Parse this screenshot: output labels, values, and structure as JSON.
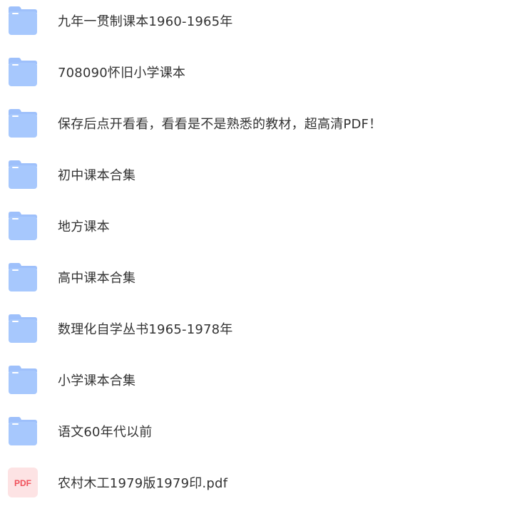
{
  "colors": {
    "folder_top": "#a9cbff",
    "folder_bottom": "#8fb6f7",
    "folder_tab": "#9ec0fb",
    "folder_highlight": "#ffffff",
    "pdf_bg": "#fde3e4",
    "pdf_text": "#f0505a",
    "text": "#333333"
  },
  "items": [
    {
      "name": "九年一贯制课本1960-1965年",
      "type": "folder",
      "icon": "folder-icon"
    },
    {
      "name": "708090怀旧小学课本",
      "type": "folder",
      "icon": "folder-icon"
    },
    {
      "name": "保存后点开看看，看看是不是熟悉的教材，超高清PDF！",
      "type": "folder",
      "icon": "folder-icon"
    },
    {
      "name": "初中课本合集",
      "type": "folder",
      "icon": "folder-icon"
    },
    {
      "name": "地方课本",
      "type": "folder",
      "icon": "folder-icon"
    },
    {
      "name": "高中课本合集",
      "type": "folder",
      "icon": "folder-icon"
    },
    {
      "name": "数理化自学丛书1965-1978年",
      "type": "folder",
      "icon": "folder-icon"
    },
    {
      "name": "小学课本合集",
      "type": "folder",
      "icon": "folder-icon"
    },
    {
      "name": "语文60年代以前",
      "type": "folder",
      "icon": "folder-icon"
    },
    {
      "name": "农村木工1979版1979印.pdf",
      "type": "pdf",
      "icon": "pdf-file-icon",
      "badge": "PDF"
    }
  ]
}
